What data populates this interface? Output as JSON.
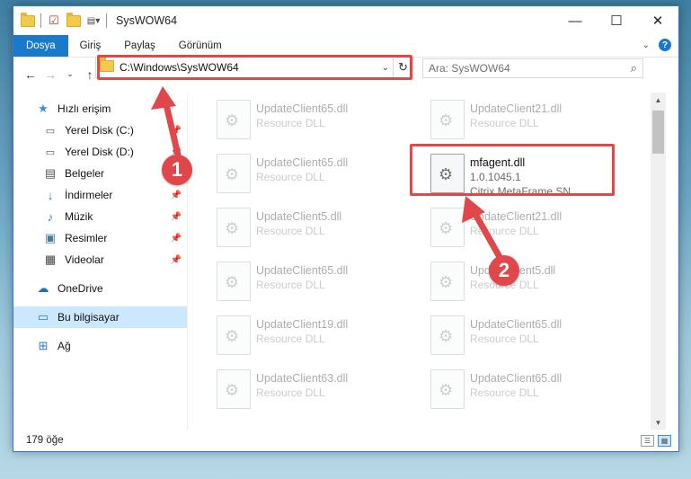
{
  "window": {
    "title": "SysWOW64",
    "controls": [
      "minimize",
      "maximize",
      "close"
    ]
  },
  "ribbon": {
    "tabs": [
      {
        "label": "Dosya"
      },
      {
        "label": "Giriş"
      },
      {
        "label": "Paylaş"
      },
      {
        "label": "Görünüm"
      }
    ]
  },
  "navbar": {
    "address": "C:\\Windows\\SysWOW64",
    "search_placeholder": "Ara: SysWOW64"
  },
  "sidebar": {
    "items": [
      {
        "label": "Hızlı erişim",
        "icon": "star-icon"
      },
      {
        "label": "Yerel Disk (C:)",
        "icon": "drive-icon"
      },
      {
        "label": "Yerel Disk (D:)",
        "icon": "drive-icon"
      },
      {
        "label": "Belgeler",
        "icon": "documents-icon"
      },
      {
        "label": "İndirmeler",
        "icon": "download-icon"
      },
      {
        "label": "Müzik",
        "icon": "music-icon"
      },
      {
        "label": "Resimler",
        "icon": "pictures-icon"
      },
      {
        "label": "Videolar",
        "icon": "video-icon"
      },
      {
        "label": "OneDrive",
        "icon": "cloud-icon"
      },
      {
        "label": "Bu bilgisayar",
        "icon": "computer-icon"
      },
      {
        "label": "Ağ",
        "icon": "network-icon"
      }
    ]
  },
  "files": [
    {
      "name": "UpdateClient65.dll",
      "sub": "Resource DLL"
    },
    {
      "name": "UpdateClient21.dll",
      "sub": "Resource DLL"
    },
    {
      "name": "UpdateClient65.dll",
      "sub": "Resource DLL"
    },
    {
      "name": "mfagent.dll",
      "sub": "1.0.1045.1",
      "sub2": "Citrix MetaFrame SN..."
    },
    {
      "name": "UpdateClient5.dll",
      "sub": "Resource DLL"
    },
    {
      "name": "UpdateClient21.dll",
      "sub": "Resource DLL"
    },
    {
      "name": "UpdateClient65.dll",
      "sub": "Resource DLL"
    },
    {
      "name": "UpdateClient5.dll",
      "sub": "Resource DLL"
    },
    {
      "name": "UpdateClient19.dll",
      "sub": "Resource DLL"
    },
    {
      "name": "UpdateClient65.dll",
      "sub": "Resource DLL"
    },
    {
      "name": "UpdateClient63.dll",
      "sub": "Resource DLL"
    },
    {
      "name": "UpdateClient65.dll",
      "sub": "Resource DLL"
    }
  ],
  "status": {
    "count": "179 öğe"
  },
  "markers": {
    "one": "1",
    "two": "2"
  },
  "colors": {
    "accent": "#1979ca",
    "highlight": "#e0474b",
    "selected": "#cce8ff"
  }
}
